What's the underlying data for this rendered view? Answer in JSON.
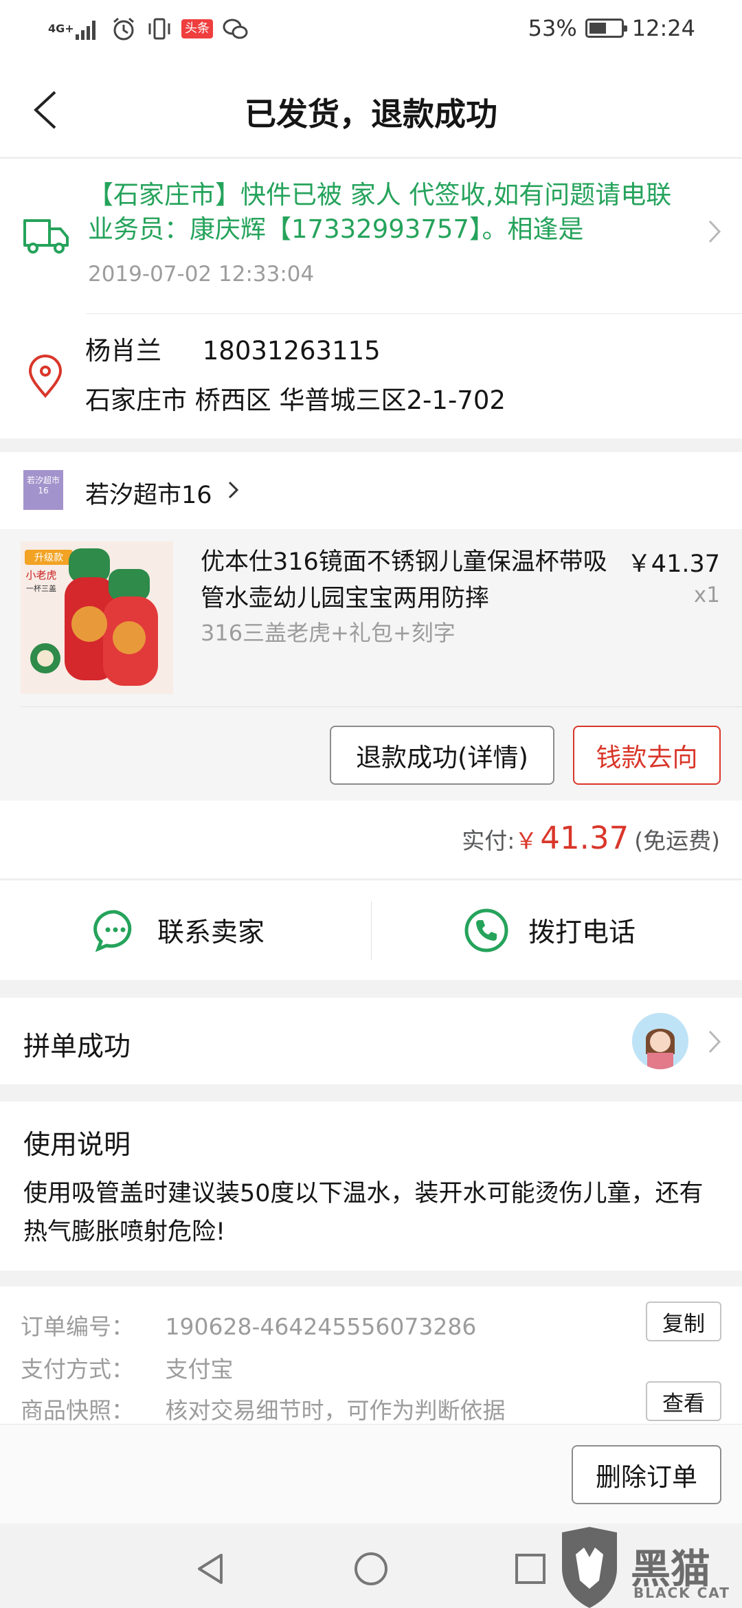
{
  "status_bar": {
    "network": "4G+",
    "toutiao_badge": "头条",
    "battery": "53%",
    "time": "12:24"
  },
  "header": {
    "title": "已发货，退款成功"
  },
  "logistics": {
    "message": "【石家庄市】快件已被 家人 代签收,如有问题请电联业务员：康庆辉【17332993757】。相逢是",
    "time": "2019-07-02 12:33:04"
  },
  "address": {
    "name": "杨肖兰",
    "phone": "18031263115",
    "detail": "石家庄市 桥西区 华普城三区2-1-702"
  },
  "store": {
    "logo_text": "若汐超市16",
    "name": "若汐超市16"
  },
  "product": {
    "title": "优本仕316镜面不锈钢儿童保温杯带吸管水壶幼儿园宝宝两用防摔",
    "sku": "316三盖老虎+礼包+刻字",
    "price": "￥41.37",
    "quantity": "x1",
    "image_badge_1": "升级款",
    "image_badge_2": "小老虎",
    "image_badge_3": "一杯三盖",
    "refund_button": "退款成功(详情)",
    "money_button": "钱款去向"
  },
  "payment": {
    "label": "实付:",
    "currency": "￥",
    "amount": "41.37",
    "note": "(免运费)"
  },
  "contact": {
    "chat_label": "联系卖家",
    "call_label": "拨打电话"
  },
  "group": {
    "label": "拼单成功"
  },
  "usage": {
    "title": "使用说明",
    "text": "使用吸管盖时建议装50度以下温水，装开水可能烫伤儿童，还有热气膨胀喷射危险!"
  },
  "order_info": {
    "order_no_label": "订单编号：",
    "order_no": "190628-464245556073286",
    "copy_button": "复制",
    "pay_method_label": "支付方式：",
    "pay_method": "支付宝",
    "snapshot_label": "商品快照：",
    "snapshot_text": "核对交易细节时，可作为判断依据",
    "view_button": "查看"
  },
  "actions": {
    "delete_button": "删除订单"
  },
  "watermark": {
    "title": "黑猫",
    "subtitle": "BLACK CAT"
  },
  "colors": {
    "green": "#25a35b",
    "red": "#d9362a",
    "gray_text": "#9c9c9c"
  }
}
